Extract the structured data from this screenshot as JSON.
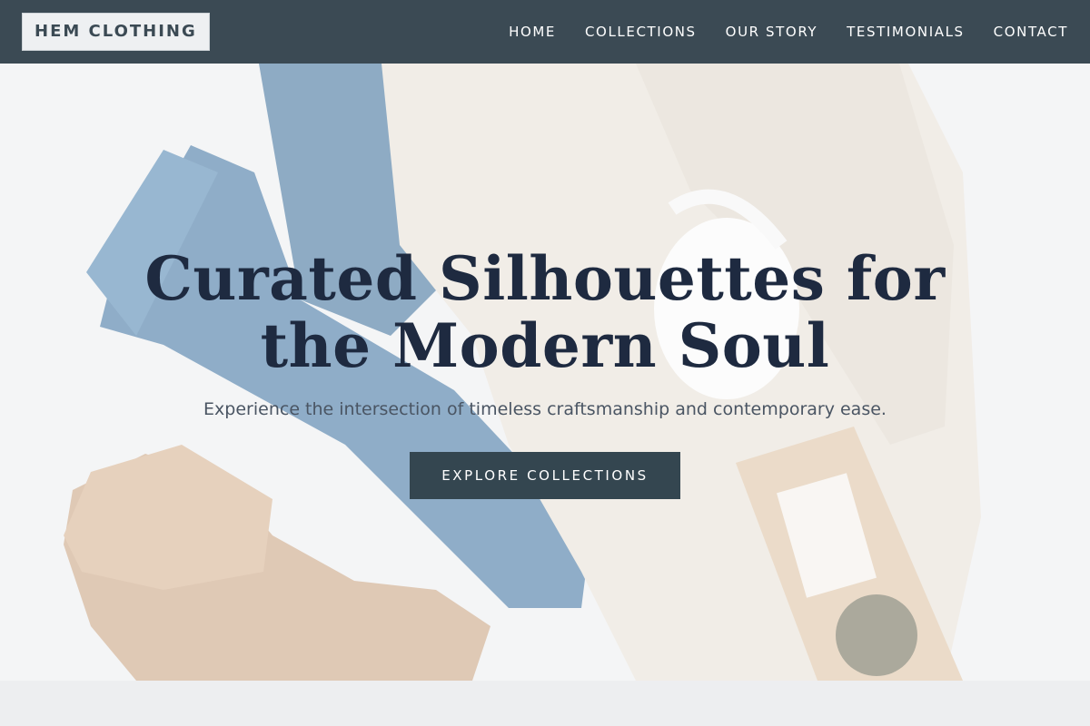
{
  "nav": {
    "logo": "HEM CLOTHING",
    "links": [
      "HOME",
      "COLLECTIONS",
      "OUR STORY",
      "TESTIMONIALS",
      "CONTACT"
    ]
  },
  "hero": {
    "title_line1": "Curated Silhouettes for",
    "title_line2": "the Modern Soul",
    "subtitle": "Experience the intersection of timeless craftsmanship and contemporary ease.",
    "cta_label": "EXPLORE COLLECTIONS",
    "image_subject": "flat-lay of jeans, knit sweater, suede boot, white mug and tea packet"
  },
  "colors": {
    "navbar": "#3b4a54",
    "title": "#1e2a40",
    "cta": "#344650"
  }
}
